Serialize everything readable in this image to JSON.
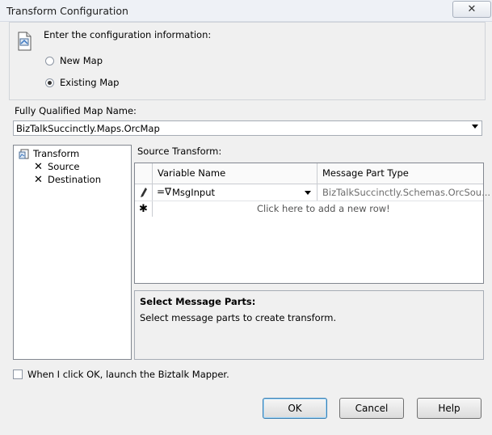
{
  "window": {
    "title": "Transform Configuration",
    "close_glyph": "✕"
  },
  "header": {
    "instruction": "Enter the configuration information:",
    "icon": "document-config-icon"
  },
  "map_choice": {
    "new_map_label": "New Map",
    "existing_map_label": "Existing Map",
    "selected": "Existing Map"
  },
  "map_name": {
    "label": "Fully Qualified Map Name:",
    "value": "BizTalkSuccinctly.Maps.OrcMap"
  },
  "tree": {
    "root_label": "Transform",
    "children": [
      "Source",
      "Destination"
    ]
  },
  "source_transform": {
    "label": "Source Transform:",
    "columns": [
      "Variable Name",
      "Message Part Type"
    ],
    "rows": [
      {
        "variable": "MsgInput",
        "type": "BizTalkSuccinctly.Schemas.OrcSou..."
      }
    ],
    "new_row_text": "Click here to add a new row!"
  },
  "message_parts": {
    "heading": "Select Message Parts:",
    "description": "Select message parts to create transform."
  },
  "launch_mapper": {
    "label": "When I click OK, launch the Biztalk Mapper.",
    "checked": false
  },
  "buttons": {
    "ok": "OK",
    "cancel": "Cancel",
    "help": "Help"
  }
}
